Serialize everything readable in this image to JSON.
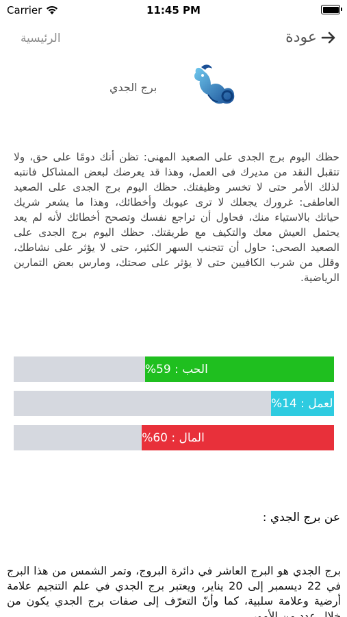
{
  "status_bar": {
    "carrier": "Carrier",
    "time": "11:45 PM"
  },
  "nav": {
    "back_label": "عودة",
    "home_label": "الرئيسية"
  },
  "sign": {
    "name": "برج الجدي",
    "logo_icon": "capricorn-logo-icon"
  },
  "horoscope_text": "حظك اليوم برج الجدى على الصعيد المهنى: تظن أنك دومًا على حق، ولا تتقبل النقد من مديرك فى العمل، وهذا قد يعرضك لبعض المشاكل فانتبه لذلك الأمر حتى لا تخسر وظيفتك. حظك اليوم برج الجدى على الصعيد العاطفى: غرورك يجعلك لا ترى عيوبك وأخطائك، وهذا ما يشعر شريك حياتك بالاستياء منك، فحاول أن تراجع نفسك وتصحح أخطائك لأنه لم يعد يحتمل العيش معك والتكيف مع طريقتك. حظك اليوم برج الجدى على الصعيد الصحى: حاول أن تتجنب السهر الكثير، حتى لا يؤثر على نشاطك، وقلل من شرب الكافيين حتى لا يؤثر على صحتك، ومارس بعض التمارين الرياضية.",
  "bars": [
    {
      "label": "الحب : 59%",
      "percent": 59,
      "color": "#1fbf1f"
    },
    {
      "label": "العمل : 14%",
      "percent": 14,
      "color": "#2ecbe0"
    },
    {
      "label": "المال : 60%",
      "percent": 60,
      "color": "#e8303a"
    }
  ],
  "about": {
    "title": "عن برج الجدي :",
    "text": "برج الجدي هو البرج العاشر في دائرة البروج، وتمر الشمس من هذا البرج في 22 ديسمبر إلى 20 يناير، ويعتبر برج الجدي في علم التنجيم علامة أرضية وعلامة سلبية، كما وأنّ التعرّف إلى صفات برج الجدي يكون من خلال عدد من الأمور"
  }
}
